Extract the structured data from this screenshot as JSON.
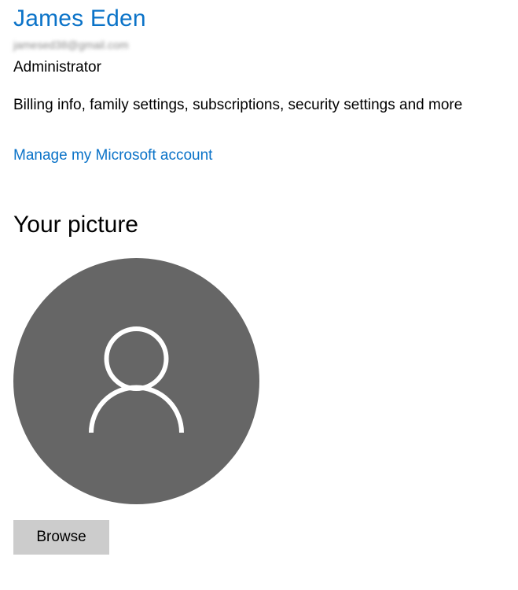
{
  "account": {
    "name": "James Eden",
    "email": "jamesed38@gmail.com",
    "role": "Administrator",
    "description": "Billing info, family settings, subscriptions, security settings and more",
    "manage_link": "Manage my Microsoft account"
  },
  "picture": {
    "title": "Your picture",
    "icon": "user-silhouette-icon",
    "browse_label": "Browse"
  },
  "colors": {
    "accent": "#0b73c8",
    "avatar_bg": "#666666",
    "button_bg": "#cccccc"
  }
}
